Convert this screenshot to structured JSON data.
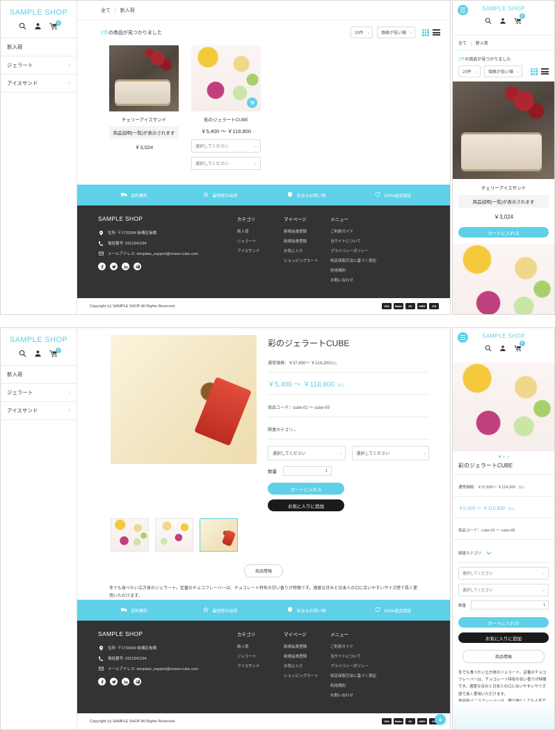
{
  "brand": "SAMPLE SHOP",
  "sidebar": {
    "items": [
      {
        "label": "新入荷",
        "chevron": ""
      },
      {
        "label": "ジェラート",
        "chevron": "›"
      },
      {
        "label": "アイスサンド",
        "chevron": "›"
      }
    ]
  },
  "listing": {
    "breadcrumb_all": "全て",
    "breadcrumb_sep": "|",
    "breadcrumb_current": "新入荷",
    "found_count": "2件",
    "found_suffix": "の商品が見つかりました",
    "per_page": "20件",
    "sort": "価格が低い順",
    "caret": "⌄",
    "products": [
      {
        "name": "チェリーアイスサンド",
        "desc": "商品説明(一覧)が表示されます",
        "price": "￥3,024"
      },
      {
        "name": "彩のジェラートCUBE",
        "price_range": "￥5,400 ～ ￥118,800",
        "select1": "選択してください",
        "select2": "選択してください"
      }
    ],
    "mobile_cart_button": "カートに入れる"
  },
  "features": [
    {
      "icon": "truck-icon",
      "label": "送料無料"
    },
    {
      "icon": "star-icon",
      "label": "最短即日出荷"
    },
    {
      "icon": "shield-icon",
      "label": "安全なお買い物"
    },
    {
      "icon": "refresh-icon",
      "label": "100%返金保証"
    }
  ],
  "footer": {
    "brand": "SAMPLE SHOP",
    "address": "住所: 〒1730004 板橋区板橋",
    "phone": "電話番号: 0312341234",
    "email": "メールアドレス: template_support@enses-cube.com",
    "socials": [
      "f",
      "t",
      "in",
      "p"
    ],
    "columns": [
      {
        "title": "カテゴリ",
        "links": [
          "新入荷",
          "ジェラート",
          "アイスサンド"
        ]
      },
      {
        "title": "マイページ",
        "links": [
          "新規会員登録",
          "新規会員登録",
          "お気に入り",
          "ショッピングカート"
        ]
      },
      {
        "title": "メニュー",
        "links": [
          "ご利用ガイド",
          "当サイトについて",
          "プライバシーポリシー",
          "特定商取引法に基づく表記",
          "利用規約",
          "お問い合わせ"
        ]
      }
    ],
    "copyright": "Copyright (c) SAMPLE SHOP All Rights Reserved.",
    "cards": [
      "VISA",
      "Mastro",
      "MC",
      "AMEX",
      "JCB"
    ]
  },
  "detail": {
    "title": "彩のジェラートCUBE",
    "normal_price_label": "通常価格：",
    "normal_price": "￥37,800～ ￥124,200",
    "tax_note": "税込",
    "sale_price": "￥5,400 ～ ￥118,800",
    "code_label": "商品コード：",
    "code_value": "cube-01 ～ cube-09",
    "related_cat": "関連カテゴリ",
    "caret": "⌄",
    "select1": "選択してください",
    "select2": "選択してください",
    "qty_label": "数量",
    "qty_value": "1",
    "cart_button": "カートに入れる",
    "fav_button": "お気に入りに追加",
    "info_tab": "商品情報",
    "description_line1": "冬でも食べたい立方体のジェラート。定番のチョコフレーバーは、チョコレート特有の甘い香りが特徴です。適度な甘みと日本人の口に合いやすいサイズ感で長く愛用いただけます。",
    "description_line2": "最高級バニラフレーバーは、贈り物としても人気です。"
  },
  "colors": {
    "accent": "#5ed0e8",
    "dark": "#333333",
    "black": "#1a1a1a"
  },
  "icons": {
    "search": "search-icon",
    "user": "user-icon",
    "cart": "cart-icon",
    "cart_count": "0",
    "to_top": "▲"
  }
}
